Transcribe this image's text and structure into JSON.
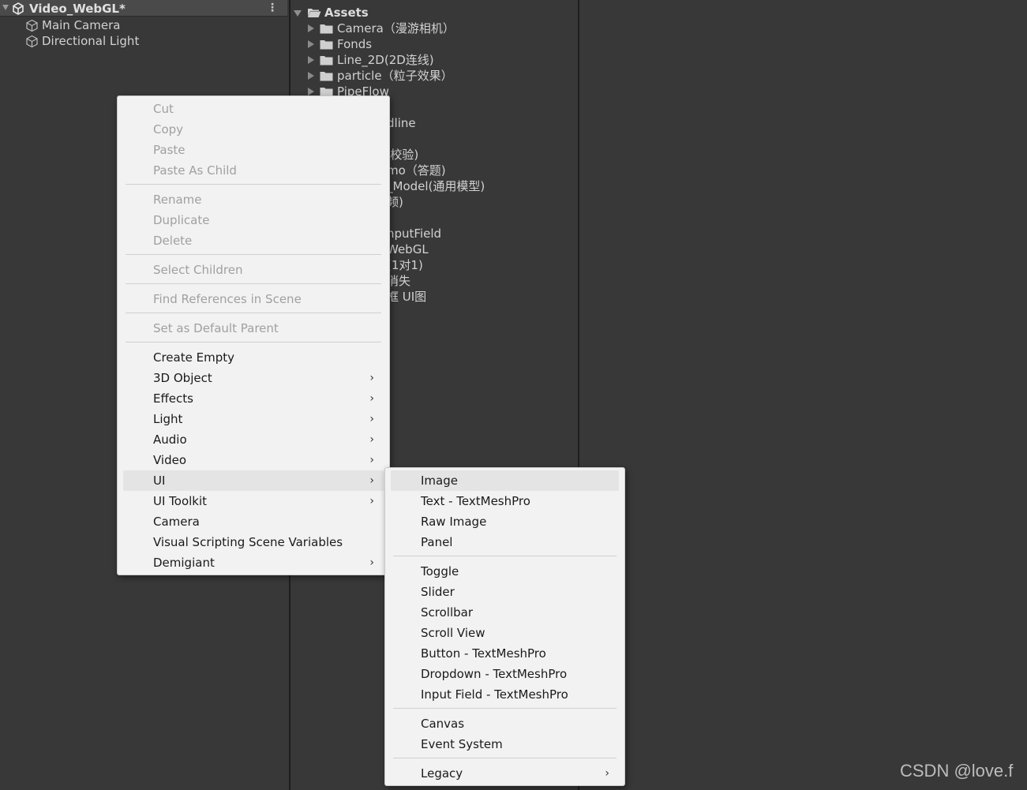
{
  "hierarchy": {
    "scene_name": "Video_WebGL*",
    "items": [
      {
        "label": "Main Camera",
        "icon": "gameobject-cube-icon"
      },
      {
        "label": "Directional Light",
        "icon": "gameobject-cube-icon"
      }
    ]
  },
  "project": {
    "root_label": "Assets",
    "folders": [
      "Camera（漫游相机）",
      "Fonds",
      "Line_2D(2D连线)",
      "particle（粒子效果）",
      "PipeFlow"
    ],
    "partially_hidden_labels": [
      "dline",
      "J校验)",
      "mo（答题)",
      "_Model(通用模型)",
      "频)",
      "nputField",
      "WebGL",
      "(1对1)",
      "消失",
      "框 UI图"
    ]
  },
  "context_menu": {
    "groups": [
      [
        {
          "label": "Cut",
          "enabled": false
        },
        {
          "label": "Copy",
          "enabled": false
        },
        {
          "label": "Paste",
          "enabled": false
        },
        {
          "label": "Paste As Child",
          "enabled": false
        }
      ],
      [
        {
          "label": "Rename",
          "enabled": false
        },
        {
          "label": "Duplicate",
          "enabled": false
        },
        {
          "label": "Delete",
          "enabled": false
        }
      ],
      [
        {
          "label": "Select Children",
          "enabled": false
        }
      ],
      [
        {
          "label": "Find References in Scene",
          "enabled": false
        }
      ],
      [
        {
          "label": "Set as Default Parent",
          "enabled": false
        }
      ],
      [
        {
          "label": "Create Empty",
          "enabled": true,
          "submenu": false
        },
        {
          "label": "3D Object",
          "enabled": true,
          "submenu": true
        },
        {
          "label": "Effects",
          "enabled": true,
          "submenu": true
        },
        {
          "label": "Light",
          "enabled": true,
          "submenu": true
        },
        {
          "label": "Audio",
          "enabled": true,
          "submenu": true
        },
        {
          "label": "Video",
          "enabled": true,
          "submenu": true
        },
        {
          "label": "UI",
          "enabled": true,
          "submenu": true,
          "highlighted": true
        },
        {
          "label": "UI Toolkit",
          "enabled": true,
          "submenu": true
        },
        {
          "label": "Camera",
          "enabled": true,
          "submenu": false
        },
        {
          "label": "Visual Scripting Scene Variables",
          "enabled": true,
          "submenu": false
        },
        {
          "label": "Demigiant",
          "enabled": true,
          "submenu": true
        }
      ]
    ]
  },
  "ui_submenu": {
    "groups": [
      [
        {
          "label": "Image",
          "highlighted": true
        },
        {
          "label": "Text - TextMeshPro"
        },
        {
          "label": "Raw Image"
        },
        {
          "label": "Panel"
        }
      ],
      [
        {
          "label": "Toggle"
        },
        {
          "label": "Slider"
        },
        {
          "label": "Scrollbar"
        },
        {
          "label": "Scroll View"
        },
        {
          "label": "Button - TextMeshPro"
        },
        {
          "label": "Dropdown - TextMeshPro"
        },
        {
          "label": "Input Field - TextMeshPro"
        }
      ],
      [
        {
          "label": "Canvas"
        },
        {
          "label": "Event System"
        }
      ],
      [
        {
          "label": "Legacy",
          "submenu": true
        }
      ]
    ]
  },
  "watermark": "CSDN @love.f",
  "colors": {
    "editor_bg": "#383838",
    "menu_bg": "#f2f2f2",
    "menu_highlight": "#e4e4e4",
    "disabled_text": "#a0a0a0"
  }
}
